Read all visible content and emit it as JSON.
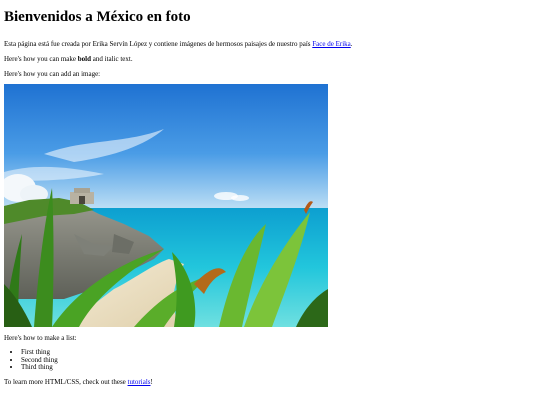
{
  "page": {
    "title": "Bienvenidos a México en foto",
    "intro": {
      "text_before": "Esta página está fue creada por Erika Servín López y contiene imágenes de hermosos paisajes de nuestro país ",
      "link_label": "Face de Erika",
      "text_after": "."
    },
    "formatting": {
      "text_before": "Here's how you can make ",
      "bold_text": "bold",
      "text_after": " and italic text."
    },
    "image_intro": "Here's how you can add an image:",
    "list_intro": "Here's how to make a list:",
    "list_items": [
      "First thing",
      "Second thing",
      "Third thing"
    ],
    "learn_more": {
      "text_before": "To learn more HTML/CSS, check out these ",
      "link_label": "tutorials",
      "text_after": "!"
    }
  },
  "colors": {
    "link": "#0000ee",
    "sky": "#1f7fd6",
    "sea": "#1ac4dc",
    "foliage": "#3f9a20"
  }
}
